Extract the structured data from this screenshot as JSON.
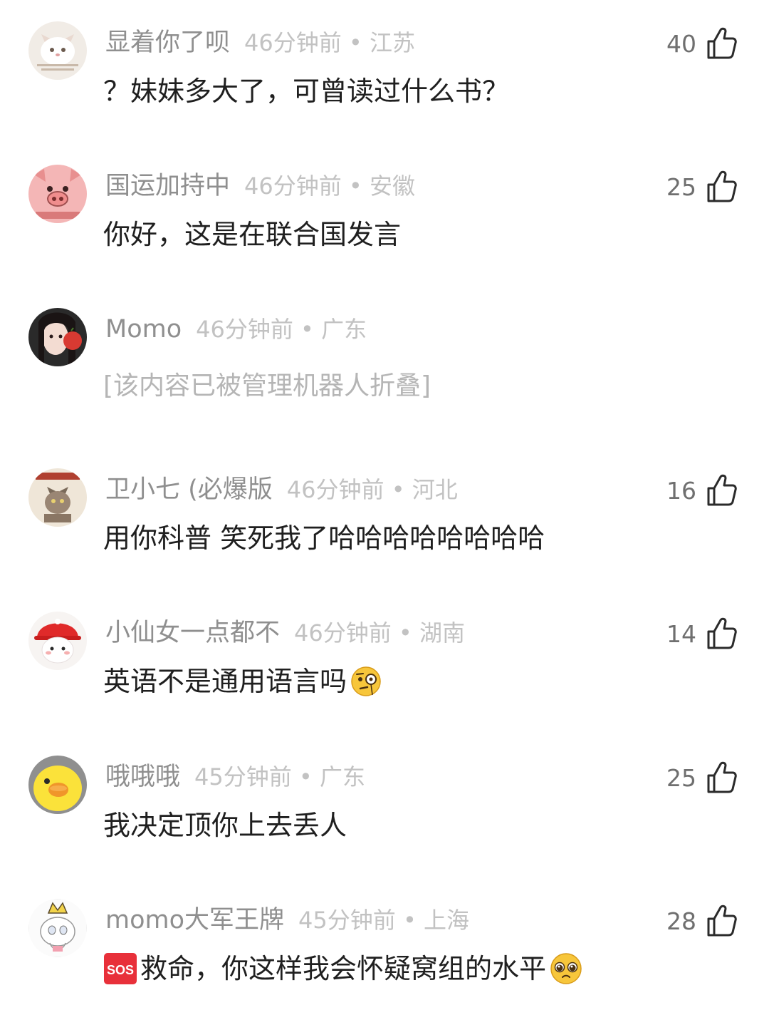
{
  "comments": [
    {
      "username": "显着你了呗",
      "time": "46分钟前",
      "location": "江苏",
      "separator": "•",
      "text": "？妹妹多大了，可曾读过什么书？",
      "likes": "40",
      "avatar_icon": "cat-avatar-icon"
    },
    {
      "username": "国运加持中",
      "time": "46分钟前",
      "location": "安徽",
      "separator": "•",
      "text": "你好，这是在联合国发言",
      "likes": "25",
      "avatar_icon": "pig-avatar-icon"
    },
    {
      "username": "Momo",
      "time": "46分钟前",
      "location": "广东",
      "separator": "•",
      "text": "[该内容已被管理机器人折叠]",
      "avatar_icon": "girl-avatar-icon"
    },
    {
      "username": "卫小七 (必爆版",
      "time": "46分钟前",
      "location": "河北",
      "separator": "•",
      "text": "用你科普 笑死我了哈哈哈哈哈哈哈哈",
      "likes": "16",
      "avatar_icon": "cat-book-avatar-icon"
    },
    {
      "username": "小仙女一点都不",
      "time": "46分钟前",
      "location": "湖南",
      "separator": "•",
      "text": "英语不是通用语言吗",
      "likes": "14",
      "avatar_icon": "red-hat-bear-avatar-icon",
      "emoji": "monocle-face-emoji"
    },
    {
      "username": "哦哦哦",
      "time": "45分钟前",
      "location": "广东",
      "separator": "•",
      "text": "我决定顶你上去丢人",
      "likes": "25",
      "avatar_icon": "yellow-duck-avatar-icon"
    },
    {
      "username": "momo大军王牌",
      "time": "45分钟前",
      "location": "上海",
      "separator": "•",
      "text": "救命，你这样我会怀疑窝组的水平",
      "likes": "28",
      "avatar_icon": "crown-avatar-icon",
      "prefix_emoji": "sos-emoji",
      "prefix_label": "SOS",
      "emoji": "pleading-face-emoji"
    }
  ],
  "colors": {
    "username": "#8f8f8f",
    "meta": "#c2c2c2",
    "body": "#1f1f1f",
    "folded": "#b5b5b5",
    "like_count": "#6f6f6f"
  }
}
